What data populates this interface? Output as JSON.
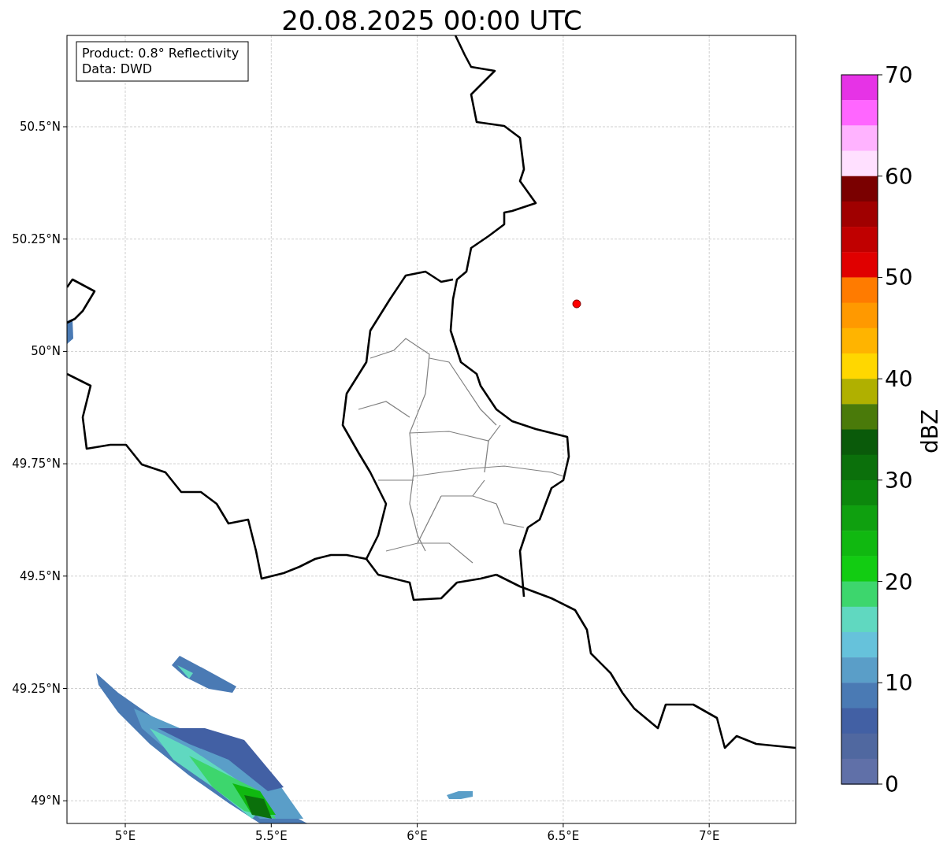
{
  "title": "20.08.2025 00:00 UTC",
  "info_box": [
    "Product: 0.8° Reflectivity",
    "Data: DWD"
  ],
  "x_ticks": [
    "5°E",
    "5.5°E",
    "6°E",
    "6.5°E",
    "7°E"
  ],
  "y_ticks": [
    "50.5°N",
    "50.25°N",
    "50°N",
    "49.75°N",
    "49.5°N",
    "49.25°N",
    "49°N"
  ],
  "colorbar": {
    "label": "dBZ",
    "ticks": [
      "70",
      "60",
      "50",
      "40",
      "30",
      "20",
      "10",
      "0"
    ],
    "bands": [
      {
        "color": "#e633e6"
      },
      {
        "color": "#ff66ff"
      },
      {
        "color": "#ffb3ff"
      },
      {
        "color": "#ffe0ff"
      },
      {
        "color": "#7a0000"
      },
      {
        "color": "#a00000"
      },
      {
        "color": "#c00000"
      },
      {
        "color": "#e00000"
      },
      {
        "color": "#ff7b00"
      },
      {
        "color": "#ff9900"
      },
      {
        "color": "#ffb400"
      },
      {
        "color": "#ffd700"
      },
      {
        "color": "#b0b000"
      },
      {
        "color": "#4a7a0a"
      },
      {
        "color": "#0a5a0a"
      },
      {
        "color": "#0b700b"
      },
      {
        "color": "#0c870c"
      },
      {
        "color": "#0fa00f"
      },
      {
        "color": "#10b810"
      },
      {
        "color": "#12cc12"
      },
      {
        "color": "#3dd66d"
      },
      {
        "color": "#60d8c0"
      },
      {
        "color": "#66c2db"
      },
      {
        "color": "#5a9ec8"
      },
      {
        "color": "#4a7ab4"
      },
      {
        "color": "#4260a4"
      },
      {
        "color": "#5068a0"
      },
      {
        "color": "#6070a8"
      }
    ]
  }
}
